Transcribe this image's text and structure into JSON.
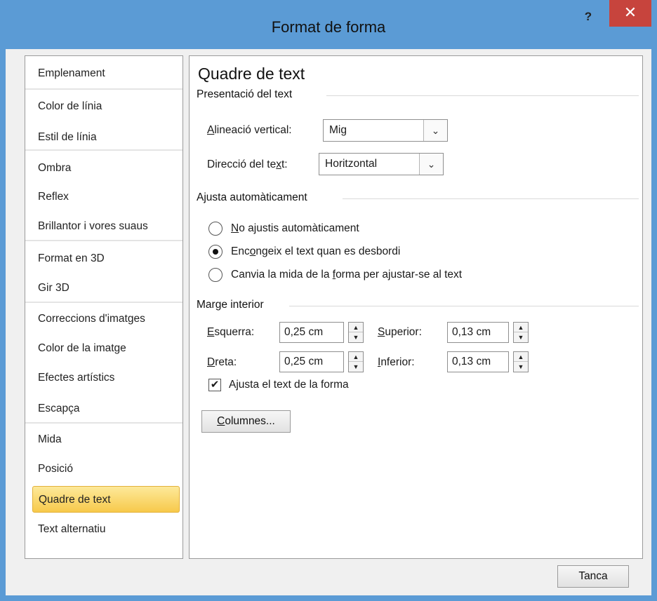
{
  "window": {
    "title": "Format de forma",
    "help_label": "?",
    "close_label": "✕"
  },
  "sidebar": {
    "items": [
      {
        "label": "Emplenament"
      },
      {
        "label": "Color de línia"
      },
      {
        "label": "Estil de línia"
      },
      {
        "label": "Ombra"
      },
      {
        "label": "Reflex"
      },
      {
        "label": "Brillantor i vores suaus"
      },
      {
        "label": "Format en 3D"
      },
      {
        "label": "Gir 3D"
      },
      {
        "label": "Correccions d'imatges"
      },
      {
        "label": "Color de la imatge"
      },
      {
        "label": "Efectes artístics"
      },
      {
        "label": "Escapça"
      },
      {
        "label": "Mida"
      },
      {
        "label": "Posició"
      },
      {
        "label": "Quadre de text"
      },
      {
        "label": "Text alternatiu"
      }
    ],
    "selected": "Quadre de text"
  },
  "panel": {
    "title": "Quadre de text",
    "layout_section": {
      "heading": "Presentació del text",
      "vertical_align": {
        "label_prefix": "",
        "label_mnemonic": "A",
        "label_rest": "lineació vertical:",
        "value": "Mig"
      },
      "text_direction": {
        "label_prefix": "Direcció del te",
        "label_mnemonic": "x",
        "label_rest": "t:",
        "value": "Horitzontal"
      }
    },
    "autofit_section": {
      "heading": "Ajusta automàticament",
      "options": [
        {
          "prefix": "",
          "mnemonic": "N",
          "rest": "o ajustis automàticament",
          "selected": false
        },
        {
          "prefix": "Enc",
          "mnemonic": "o",
          "rest": "ngeix el text quan es desbordi",
          "selected": true
        },
        {
          "prefix": "Canvia la mida de la ",
          "mnemonic": "f",
          "rest": "orma per ajustar-se al text",
          "selected": false
        }
      ]
    },
    "margin_section": {
      "heading": "Marge interior",
      "left": {
        "mnemonic": "E",
        "rest": "squerra:",
        "value": "0,25 cm"
      },
      "right": {
        "mnemonic": "D",
        "rest": "reta:",
        "value": "0,25 cm"
      },
      "top": {
        "mnemonic": "S",
        "rest": "uperior:",
        "value": "0,13 cm"
      },
      "bottom": {
        "mnemonic": "I",
        "rest": "nferior:",
        "value": "0,13 cm"
      }
    },
    "wrap_checkbox": {
      "prefix": "A",
      "mnemonic": "j",
      "rest": "usta el text de la forma",
      "checked": true,
      "check_glyph": "✔"
    },
    "columns_button": {
      "mnemonic": "C",
      "rest": "olumnes..."
    }
  },
  "footer": {
    "close_button": "Tanca"
  },
  "icons": {
    "combo_arrow": "⌄",
    "spin_up": "▲",
    "spin_down": "▼"
  },
  "colors": {
    "title_bar": "#5b9bd5",
    "close_button": "#c7443d",
    "selection": "#f7c94b"
  }
}
